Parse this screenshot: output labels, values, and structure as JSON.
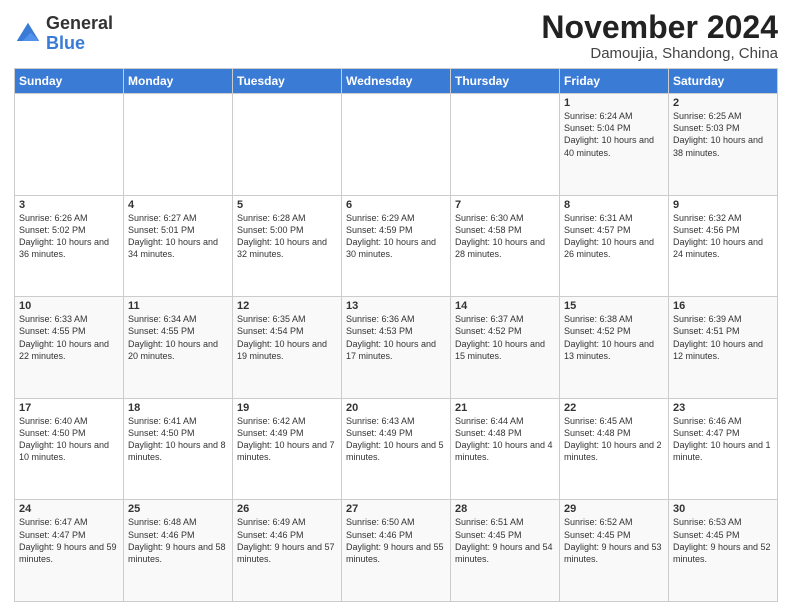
{
  "logo": {
    "general": "General",
    "blue": "Blue"
  },
  "title": "November 2024",
  "subtitle": "Damoujia, Shandong, China",
  "days_of_week": [
    "Sunday",
    "Monday",
    "Tuesday",
    "Wednesday",
    "Thursday",
    "Friday",
    "Saturday"
  ],
  "weeks": [
    [
      {
        "day": "",
        "info": ""
      },
      {
        "day": "",
        "info": ""
      },
      {
        "day": "",
        "info": ""
      },
      {
        "day": "",
        "info": ""
      },
      {
        "day": "",
        "info": ""
      },
      {
        "day": "1",
        "info": "Sunrise: 6:24 AM\nSunset: 5:04 PM\nDaylight: 10 hours and 40 minutes."
      },
      {
        "day": "2",
        "info": "Sunrise: 6:25 AM\nSunset: 5:03 PM\nDaylight: 10 hours and 38 minutes."
      }
    ],
    [
      {
        "day": "3",
        "info": "Sunrise: 6:26 AM\nSunset: 5:02 PM\nDaylight: 10 hours and 36 minutes."
      },
      {
        "day": "4",
        "info": "Sunrise: 6:27 AM\nSunset: 5:01 PM\nDaylight: 10 hours and 34 minutes."
      },
      {
        "day": "5",
        "info": "Sunrise: 6:28 AM\nSunset: 5:00 PM\nDaylight: 10 hours and 32 minutes."
      },
      {
        "day": "6",
        "info": "Sunrise: 6:29 AM\nSunset: 4:59 PM\nDaylight: 10 hours and 30 minutes."
      },
      {
        "day": "7",
        "info": "Sunrise: 6:30 AM\nSunset: 4:58 PM\nDaylight: 10 hours and 28 minutes."
      },
      {
        "day": "8",
        "info": "Sunrise: 6:31 AM\nSunset: 4:57 PM\nDaylight: 10 hours and 26 minutes."
      },
      {
        "day": "9",
        "info": "Sunrise: 6:32 AM\nSunset: 4:56 PM\nDaylight: 10 hours and 24 minutes."
      }
    ],
    [
      {
        "day": "10",
        "info": "Sunrise: 6:33 AM\nSunset: 4:55 PM\nDaylight: 10 hours and 22 minutes."
      },
      {
        "day": "11",
        "info": "Sunrise: 6:34 AM\nSunset: 4:55 PM\nDaylight: 10 hours and 20 minutes."
      },
      {
        "day": "12",
        "info": "Sunrise: 6:35 AM\nSunset: 4:54 PM\nDaylight: 10 hours and 19 minutes."
      },
      {
        "day": "13",
        "info": "Sunrise: 6:36 AM\nSunset: 4:53 PM\nDaylight: 10 hours and 17 minutes."
      },
      {
        "day": "14",
        "info": "Sunrise: 6:37 AM\nSunset: 4:52 PM\nDaylight: 10 hours and 15 minutes."
      },
      {
        "day": "15",
        "info": "Sunrise: 6:38 AM\nSunset: 4:52 PM\nDaylight: 10 hours and 13 minutes."
      },
      {
        "day": "16",
        "info": "Sunrise: 6:39 AM\nSunset: 4:51 PM\nDaylight: 10 hours and 12 minutes."
      }
    ],
    [
      {
        "day": "17",
        "info": "Sunrise: 6:40 AM\nSunset: 4:50 PM\nDaylight: 10 hours and 10 minutes."
      },
      {
        "day": "18",
        "info": "Sunrise: 6:41 AM\nSunset: 4:50 PM\nDaylight: 10 hours and 8 minutes."
      },
      {
        "day": "19",
        "info": "Sunrise: 6:42 AM\nSunset: 4:49 PM\nDaylight: 10 hours and 7 minutes."
      },
      {
        "day": "20",
        "info": "Sunrise: 6:43 AM\nSunset: 4:49 PM\nDaylight: 10 hours and 5 minutes."
      },
      {
        "day": "21",
        "info": "Sunrise: 6:44 AM\nSunset: 4:48 PM\nDaylight: 10 hours and 4 minutes."
      },
      {
        "day": "22",
        "info": "Sunrise: 6:45 AM\nSunset: 4:48 PM\nDaylight: 10 hours and 2 minutes."
      },
      {
        "day": "23",
        "info": "Sunrise: 6:46 AM\nSunset: 4:47 PM\nDaylight: 10 hours and 1 minute."
      }
    ],
    [
      {
        "day": "24",
        "info": "Sunrise: 6:47 AM\nSunset: 4:47 PM\nDaylight: 9 hours and 59 minutes."
      },
      {
        "day": "25",
        "info": "Sunrise: 6:48 AM\nSunset: 4:46 PM\nDaylight: 9 hours and 58 minutes."
      },
      {
        "day": "26",
        "info": "Sunrise: 6:49 AM\nSunset: 4:46 PM\nDaylight: 9 hours and 57 minutes."
      },
      {
        "day": "27",
        "info": "Sunrise: 6:50 AM\nSunset: 4:46 PM\nDaylight: 9 hours and 55 minutes."
      },
      {
        "day": "28",
        "info": "Sunrise: 6:51 AM\nSunset: 4:45 PM\nDaylight: 9 hours and 54 minutes."
      },
      {
        "day": "29",
        "info": "Sunrise: 6:52 AM\nSunset: 4:45 PM\nDaylight: 9 hours and 53 minutes."
      },
      {
        "day": "30",
        "info": "Sunrise: 6:53 AM\nSunset: 4:45 PM\nDaylight: 9 hours and 52 minutes."
      }
    ]
  ]
}
